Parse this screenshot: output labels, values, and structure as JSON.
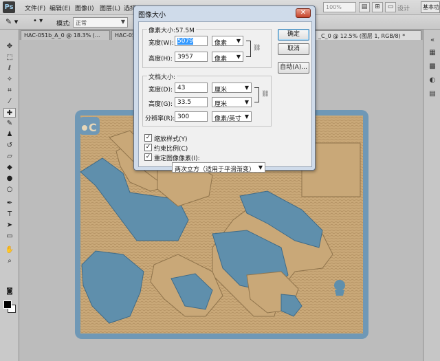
{
  "app": {
    "logo": "Ps",
    "menus": [
      "文件(F)",
      "编辑(E)",
      "图像(I)",
      "图层(L)",
      "选择"
    ],
    "zoom_value": "100%",
    "workspace_label": "设计",
    "workspace_button": "基本功"
  },
  "options_bar": {
    "mode_label": "模式:",
    "mode_value": "正常"
  },
  "tabs": [
    {
      "label": "HAC-051b_A_0 @ 18.3% (..."
    },
    {
      "label": "HAC-05"
    },
    {
      "label": "_C_0 @ 12.5% (图层 1, RGB/8) *"
    }
  ],
  "document": {
    "logo_text": "C",
    "colors": {
      "tan": "#c9a878",
      "blue": "#5f8fac",
      "frame": "#6f98b6",
      "line": "#b08e5f"
    }
  },
  "dialog": {
    "title": "图像大小",
    "pixel_group_title": "像素大小:57.5M",
    "width_label": "宽度(W):",
    "width_value": "5079",
    "width_unit": "像素",
    "height_label": "高度(H):",
    "height_value": "3957",
    "height_unit": "像素",
    "doc_group_title": "文档大小:",
    "doc_width_label": "宽度(D):",
    "doc_width_value": "43",
    "doc_width_unit": "厘米",
    "doc_height_label": "高度(G):",
    "doc_height_value": "33.5",
    "doc_height_unit": "厘米",
    "resolution_label": "分辨率(R):",
    "resolution_value": "300",
    "resolution_unit": "像素/英寸",
    "ok": "确定",
    "cancel": "取消",
    "auto": "自动(A)...",
    "scale_styles": "缩放样式(Y)",
    "constrain": "约束比例(C)",
    "resample": "重定图像像素(I):",
    "resample_method": "两次立方（适用于平滑渐变）"
  }
}
